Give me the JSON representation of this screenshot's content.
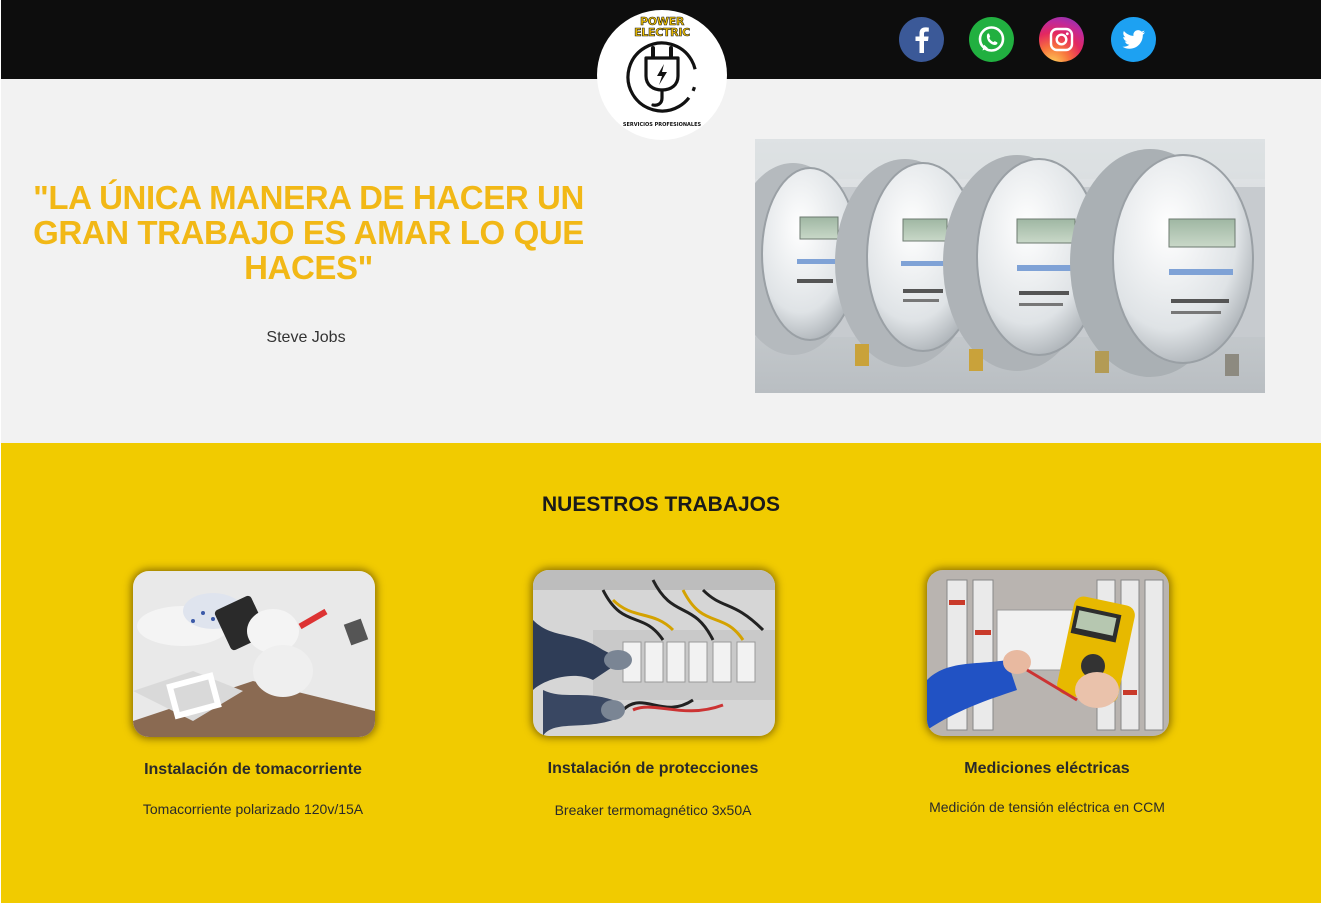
{
  "header": {
    "logo": {
      "title_line1": "POWER",
      "title_line2": "ELECTRIC",
      "subtitle": "SERVICIOS PROFESIONALES",
      "icon": "plug-icon"
    },
    "social": [
      {
        "name": "facebook",
        "icon": "facebook-icon",
        "color": "#3b5998"
      },
      {
        "name": "whatsapp",
        "icon": "whatsapp-icon",
        "color": "#21b040"
      },
      {
        "name": "instagram",
        "icon": "instagram-icon",
        "color": "#e4285f"
      },
      {
        "name": "twitter",
        "icon": "twitter-icon",
        "color": "#1da1f2"
      }
    ]
  },
  "hero": {
    "quote": "\"LA ÚNICA MANERA DE HACER UN GRAN TRABAJO ES AMAR LO QUE HACES\"",
    "author": "Steve Jobs",
    "image": "electric-meters-photo"
  },
  "works": {
    "title": "NUESTROS TRABAJOS",
    "items": [
      {
        "title": "Instalación de tomacorriente",
        "description": "Tomacorriente polarizado 120v/15A",
        "image": "outlet-installation-photo"
      },
      {
        "title": "Instalación de protecciones",
        "description": "Breaker termomagnético 3x50A",
        "image": "breaker-panel-photo"
      },
      {
        "title": "Mediciones eléctricas",
        "description": "Medición de tensión eléctrica en CCM",
        "image": "multimeter-measurement-photo"
      }
    ]
  },
  "colors": {
    "header_bg": "#0d0d0d",
    "hero_bg": "#f2f2f2",
    "accent_yellow": "#f1cb00",
    "quote_color": "#f2b816"
  }
}
